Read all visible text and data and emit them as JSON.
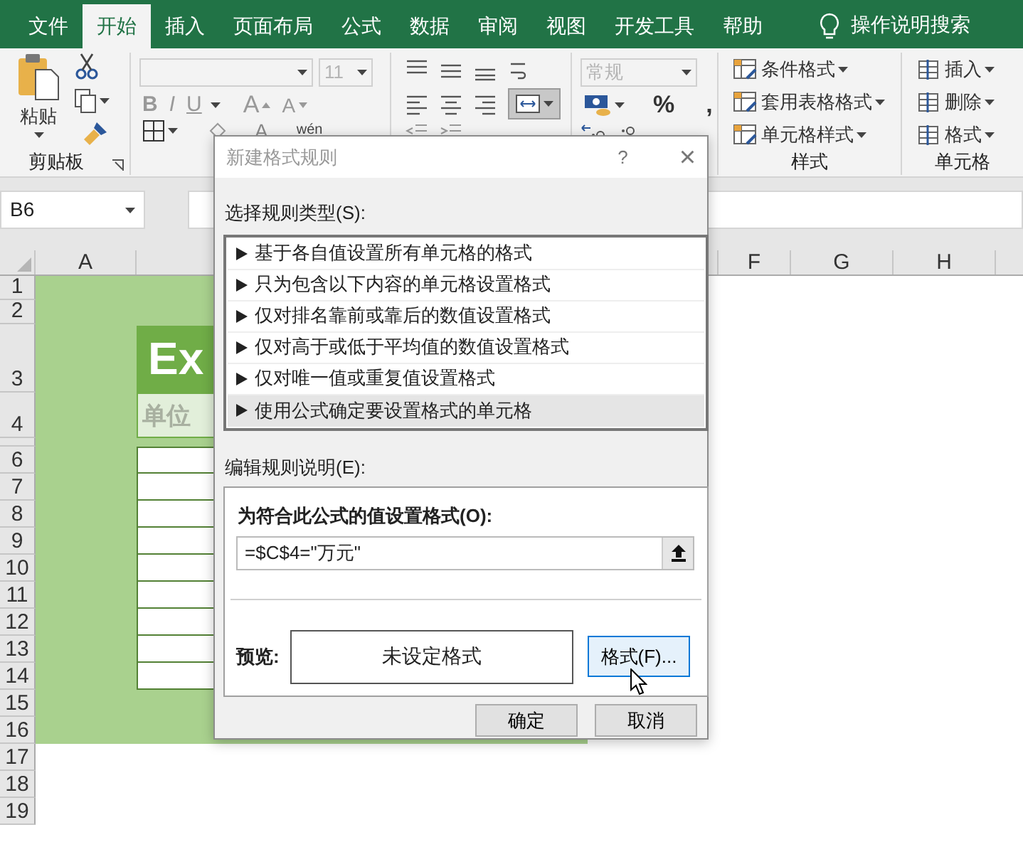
{
  "tabs": [
    {
      "label": "文件",
      "selected": false
    },
    {
      "label": "开始",
      "selected": true
    },
    {
      "label": "插入",
      "selected": false
    },
    {
      "label": "页面布局",
      "selected": false
    },
    {
      "label": "公式",
      "selected": false
    },
    {
      "label": "数据",
      "selected": false
    },
    {
      "label": "审阅",
      "selected": false
    },
    {
      "label": "视图",
      "selected": false
    },
    {
      "label": "开发工具",
      "selected": false
    },
    {
      "label": "帮助",
      "selected": false
    }
  ],
  "search": {
    "label": "操作说明搜索"
  },
  "ribbon": {
    "clipboard": {
      "paste": "粘贴",
      "label": "剪贴板"
    },
    "font": {
      "font_size": "11",
      "disabled": true,
      "style_buttons": [
        "B",
        "I",
        "U"
      ],
      "grow": "A",
      "shrink": "A",
      "font_color_label": "A",
      "phonetic": "wén"
    },
    "alignment": {
      "merge_selected": true
    },
    "number": {
      "format": "常规",
      "disabled": true,
      "symbols": [
        "%",
        ","
      ]
    },
    "styles": {
      "items": [
        "条件格式",
        "套用表格格式",
        "单元格样式"
      ],
      "label": "样式"
    },
    "cells": {
      "items": [
        "插入",
        "删除",
        "格式"
      ],
      "label": "单元格"
    }
  },
  "name_box": "B6",
  "columns": [
    "A",
    "F",
    "G",
    "H"
  ],
  "rows": [
    "1",
    "2",
    "3",
    "4",
    "6",
    "7",
    "8",
    "9",
    "10",
    "11",
    "12",
    "13",
    "14",
    "15",
    "16",
    "17",
    "18",
    "19"
  ],
  "sheet": {
    "title": "Ex",
    "unit_header": "单位"
  },
  "dialog": {
    "title": "新建格式规则",
    "help": "?",
    "close": "×",
    "type_label": "选择规则类型(S):",
    "rule_types": [
      {
        "label": "基于各自值设置所有单元格的格式",
        "selected": false
      },
      {
        "label": "只为包含以下内容的单元格设置格式",
        "selected": false
      },
      {
        "label": "仅对排名靠前或靠后的数值设置格式",
        "selected": false
      },
      {
        "label": "仅对高于或低于平均值的数值设置格式",
        "selected": false
      },
      {
        "label": "仅对唯一值或重复值设置格式",
        "selected": false
      },
      {
        "label": "使用公式确定要设置格式的单元格",
        "selected": true
      }
    ],
    "edit_label": "编辑规则说明(E):",
    "formula_label": "为符合此公式的值设置格式(O):",
    "formula": "=$C$4=\"万元\"",
    "preview_label": "预览:",
    "preview": "未设定格式",
    "format_button": "格式(F)...",
    "ok": "确定",
    "cancel": "取消"
  }
}
